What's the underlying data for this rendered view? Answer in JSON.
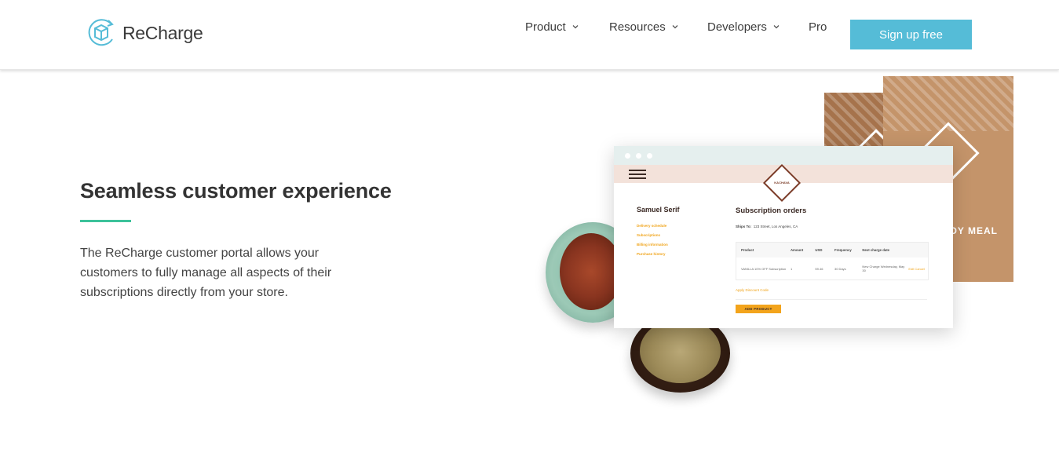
{
  "header": {
    "brand": "ReCharge",
    "nav": [
      {
        "label": "Product",
        "has_dropdown": true
      },
      {
        "label": "Resources",
        "has_dropdown": true
      },
      {
        "label": "Developers",
        "has_dropdown": true
      },
      {
        "label": "Pro",
        "has_dropdown": false
      }
    ],
    "cta_label": "Sign up free"
  },
  "hero": {
    "headline": "Seamless customer experience",
    "body": "The ReCharge customer portal allows your customers to fully manage all aspects of their subscriptions directly from your store."
  },
  "mockup": {
    "brand_logo_text": "KACHAVA",
    "customer_name": "Samuel Serif",
    "menu": [
      "Delivery schedule",
      "Subscriptions",
      "Billing information",
      "Purchase history"
    ],
    "title": "Subscription orders",
    "ships_to_label": "Ships To:",
    "ships_to_value": "123 Street, Los Angeles, CA",
    "table": {
      "headers": [
        "Product",
        "Amount",
        "USD",
        "Frequency",
        "Next charge date",
        ""
      ],
      "rows": [
        [
          "VANILLA 10% OFF Subscription",
          "1",
          "59.46",
          "30 Days",
          "New Charge Wednesday, May 30",
          "Edit Cancel"
        ]
      ]
    },
    "apply_discount": "Apply Discount Code",
    "add_product": "ADD PRODUCT",
    "bag_label": "ODY MEAL"
  },
  "colors": {
    "accent_button": "#55bcd7",
    "accent_line": "#3cc29a",
    "mock_link": "#f0a41a"
  }
}
